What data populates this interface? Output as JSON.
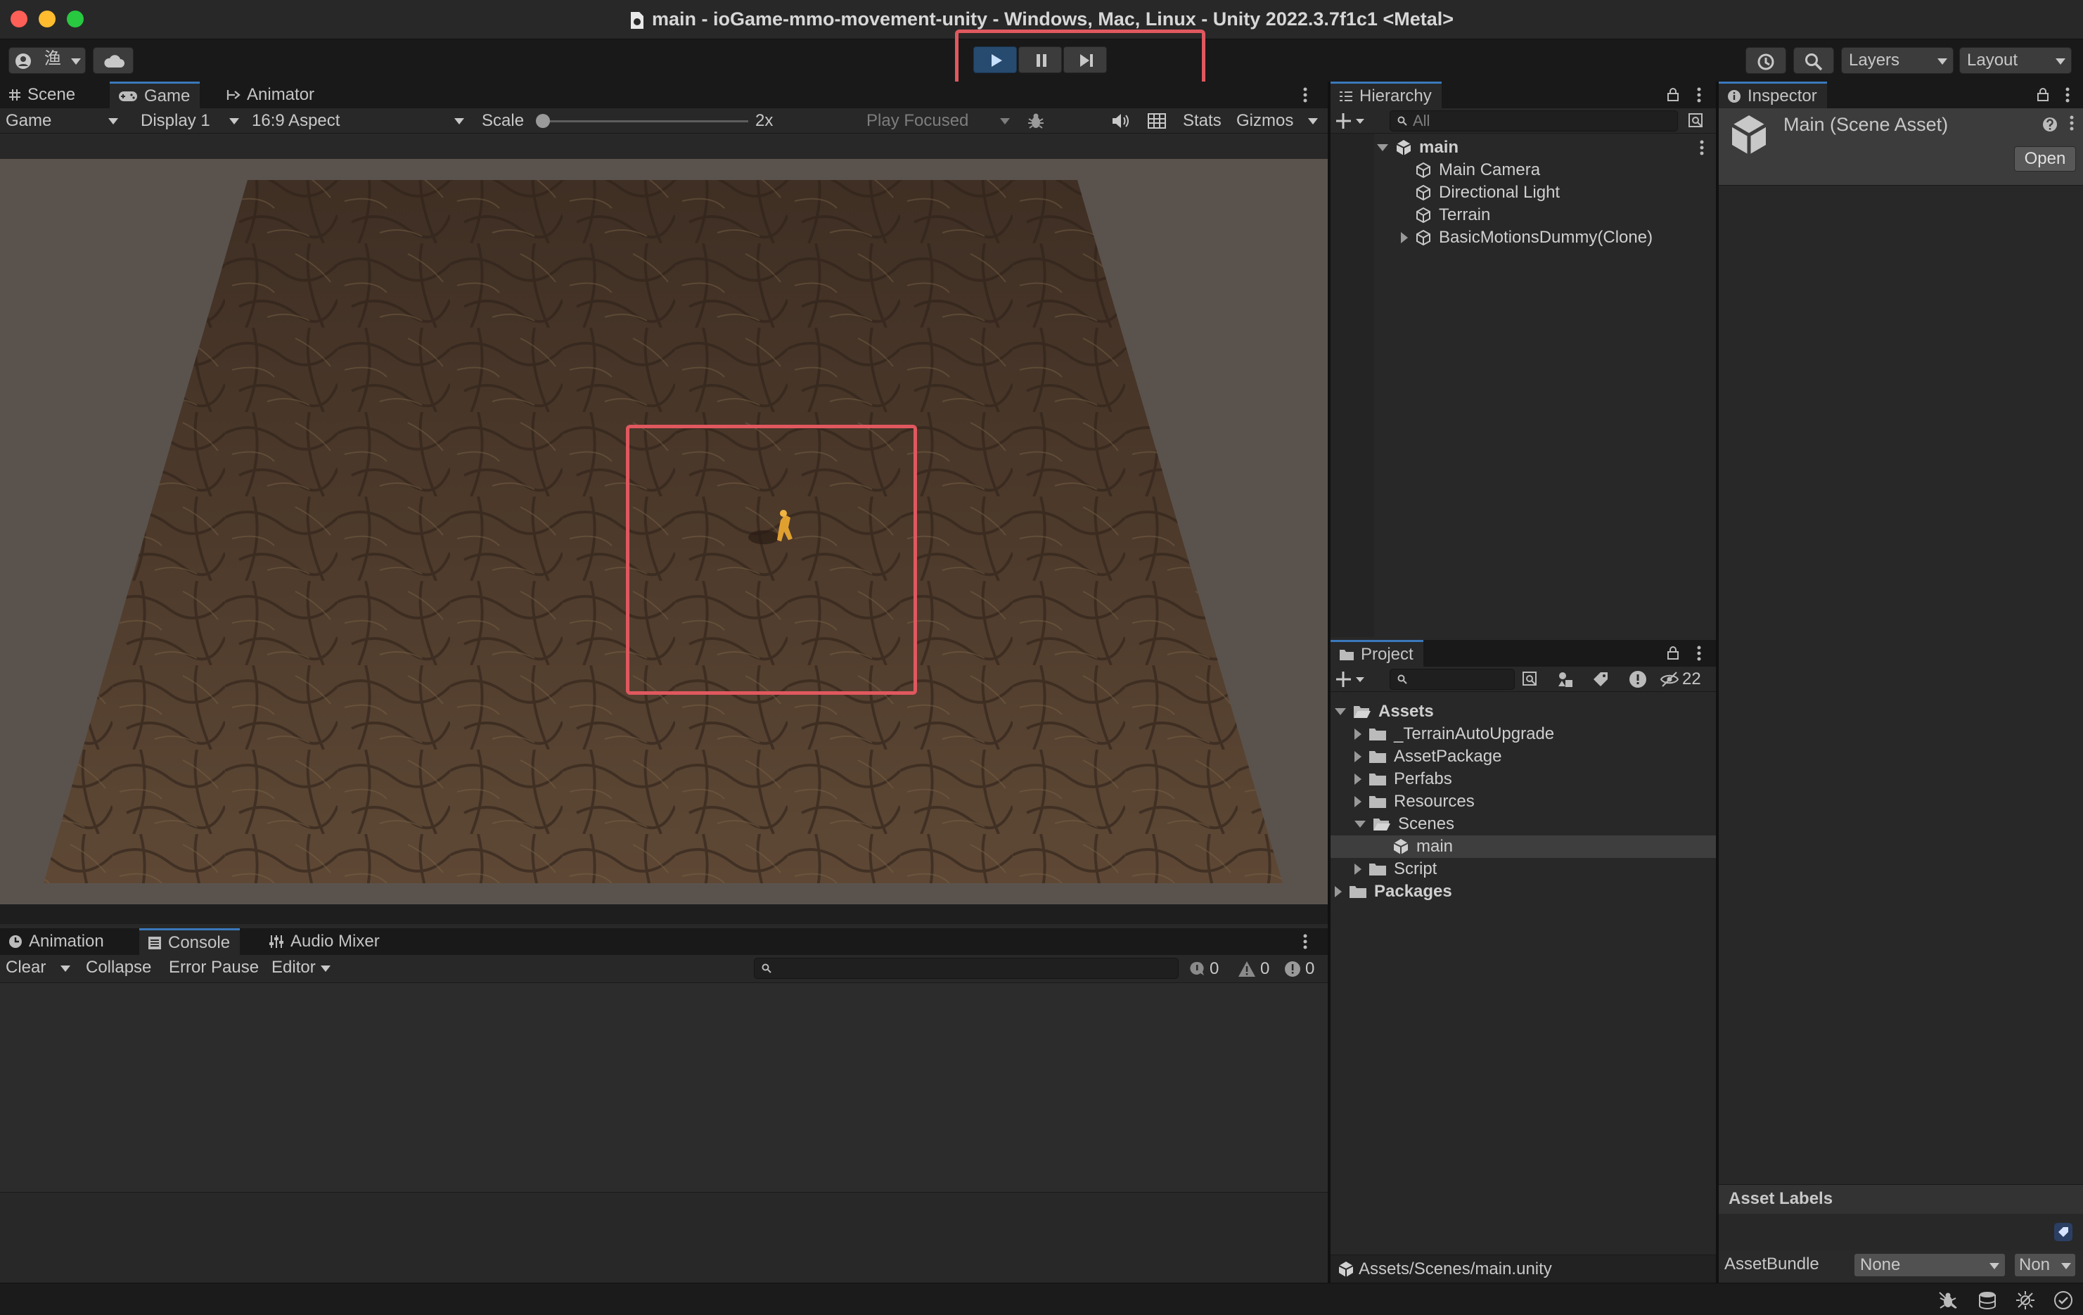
{
  "window": {
    "title": "main - ioGame-mmo-movement-unity - Windows, Mac, Linux - Unity 2022.3.7f1c1 <Metal>"
  },
  "toolbar": {
    "account_label": "渔",
    "layers_label": "Layers",
    "layout_label": "Layout"
  },
  "game_panel": {
    "tabs": [
      {
        "label": "Scene"
      },
      {
        "label": "Game"
      },
      {
        "label": "Animator"
      }
    ],
    "game_dropdown": "Game",
    "display_dropdown": "Display 1",
    "aspect_dropdown": "16:9 Aspect",
    "scale_label": "Scale",
    "scale_value": "2x",
    "play_focused": "Play Focused",
    "stats_label": "Stats",
    "gizmos_label": "Gizmos"
  },
  "console_panel": {
    "tabs": [
      {
        "label": "Animation"
      },
      {
        "label": "Console"
      },
      {
        "label": "Audio Mixer"
      }
    ],
    "clear_label": "Clear",
    "collapse_label": "Collapse",
    "error_pause_label": "Error Pause",
    "editor_label": "Editor",
    "counts": {
      "log": "0",
      "warn": "0",
      "error": "0"
    }
  },
  "hierarchy": {
    "tab": "Hierarchy",
    "search_placeholder": "All",
    "scene": "main",
    "items": [
      {
        "label": "Main Camera"
      },
      {
        "label": "Directional Light"
      },
      {
        "label": "Terrain"
      },
      {
        "label": "BasicMotionsDummy(Clone)"
      }
    ]
  },
  "project": {
    "tab": "Project",
    "hidden_count": "22",
    "root_assets": "Assets",
    "folders": [
      {
        "label": "_TerrainAutoUpgrade"
      },
      {
        "label": "AssetPackage"
      },
      {
        "label": "Perfabs"
      },
      {
        "label": "Resources"
      },
      {
        "label": "Scenes"
      },
      {
        "label": "main"
      },
      {
        "label": "Script"
      }
    ],
    "root_packages": "Packages",
    "footer_path": "Assets/Scenes/main.unity"
  },
  "inspector": {
    "tab": "Inspector",
    "asset_title": "Main (Scene Asset)",
    "open_label": "Open",
    "asset_labels_header": "Asset Labels",
    "assetbundle_label": "AssetBundle",
    "assetbundle_value": "None",
    "assetbundle_variant": "Non"
  },
  "colors": {
    "highlight": "#e0585f",
    "accent": "#3a79bb",
    "terrain": "#4e3a2b"
  }
}
